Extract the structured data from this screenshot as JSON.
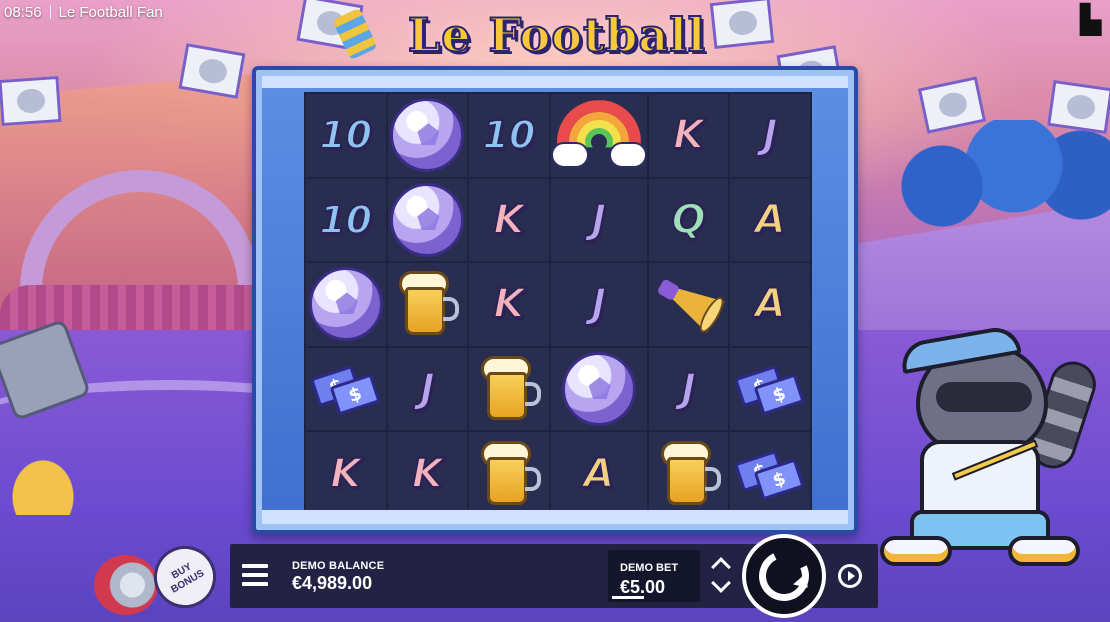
{
  "status_bar": {
    "time": "08:56",
    "window_title": "Le Football Fan"
  },
  "game": {
    "logo_text": "Le Football Fan",
    "brand_icon": "hacksaw-logo-icon"
  },
  "reels": {
    "columns": 6,
    "rows": 5,
    "grid": [
      [
        "10",
        "ball",
        "10",
        "rainbow",
        "K",
        "J"
      ],
      [
        "10",
        "ball",
        "K",
        "J",
        "Q",
        "A"
      ],
      [
        "ball",
        "beer",
        "K",
        "J",
        "horn",
        "A"
      ],
      [
        "ticket",
        "J",
        "beer",
        "ball",
        "J",
        "ticket"
      ],
      [
        "K",
        "K",
        "beer",
        "A",
        "beer",
        "ticket"
      ]
    ],
    "ticket_label": "$"
  },
  "controls": {
    "buy_bonus_label_1": "BUY",
    "buy_bonus_label_2": "BONUS",
    "menu_icon": "hamburger-menu-icon",
    "balance_label": "DEMO BALANCE",
    "balance_value": "€4,989.00",
    "bet_label": "DEMO BET",
    "bet_value": "€5.00",
    "spin_icon": "spin-icon",
    "autoplay_icon": "autoplay-icon"
  },
  "colors": {
    "frame_blue": "#5d8fe3",
    "grid_bg": "#292e50",
    "control_bar": "#1e2038",
    "logo_yellow": "#f7c93a"
  }
}
